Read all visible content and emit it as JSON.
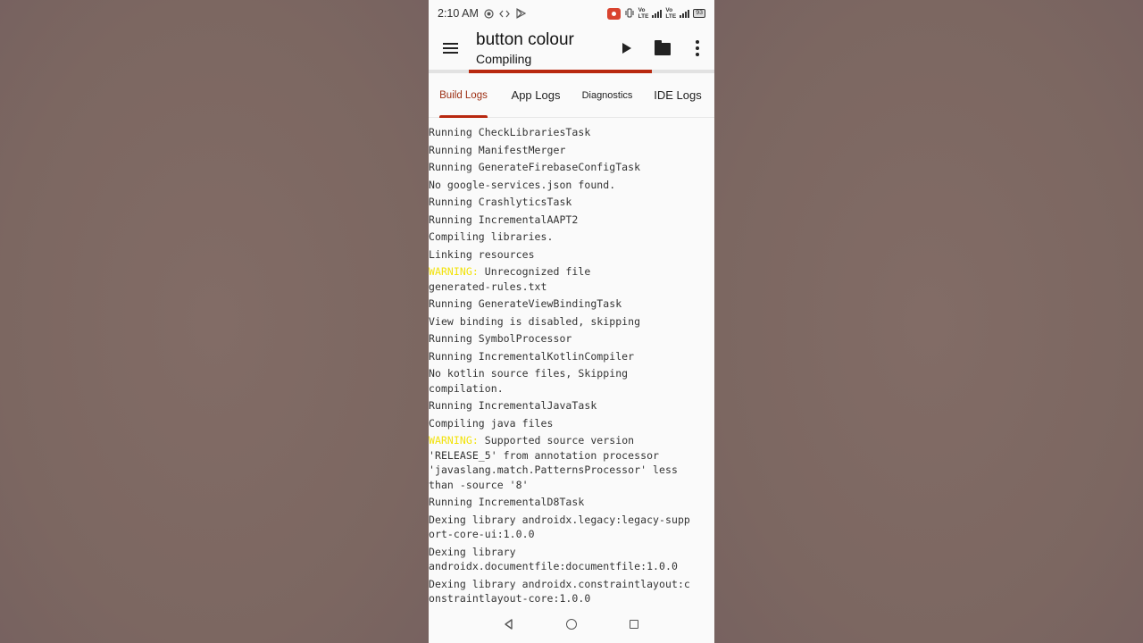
{
  "status_bar": {
    "time": "2:10 AM",
    "sim1_label_top": "Vo",
    "sim1_label_bottom": "LTE",
    "sim2_label_top": "Vo",
    "sim2_label_bottom": "LTE",
    "battery": "93",
    "icons": [
      "record-icon",
      "code-icon",
      "play-store-icon",
      "screen-record-icon",
      "vibrate-icon",
      "signal-icon",
      "battery-icon"
    ]
  },
  "toolbar": {
    "title": "button colour",
    "subtitle": "Compiling",
    "progress_fraction": 0.64,
    "progress_start_fraction": 0.14
  },
  "tabs": [
    {
      "label": "Build Logs",
      "active": true
    },
    {
      "label": "App Logs",
      "active": false
    },
    {
      "label": "Diagnostics",
      "active": false
    },
    {
      "label": "IDE Logs",
      "active": false
    }
  ],
  "log": {
    "lines": [
      {
        "warning": "",
        "text": "Running CheckLibrariesTask"
      },
      {
        "warning": "",
        "text": "Running ManifestMerger"
      },
      {
        "warning": "",
        "text": "Running GenerateFirebaseConfigTask"
      },
      {
        "warning": "",
        "text": "No google-services.json found."
      },
      {
        "warning": "",
        "text": "Running CrashlyticsTask"
      },
      {
        "warning": "",
        "text": "Running IncrementalAAPT2"
      },
      {
        "warning": "",
        "text": "Compiling libraries."
      },
      {
        "warning": "",
        "text": "Linking resources"
      },
      {
        "warning": "WARNING:",
        "text": " Unrecognized file\ngenerated-rules.txt"
      },
      {
        "warning": "",
        "text": "Running GenerateViewBindingTask"
      },
      {
        "warning": "",
        "text": "View binding is disabled, skipping"
      },
      {
        "warning": "",
        "text": "Running SymbolProcessor"
      },
      {
        "warning": "",
        "text": "Running IncrementalKotlinCompiler"
      },
      {
        "warning": "",
        "text": "No kotlin source files, Skipping\ncompilation."
      },
      {
        "warning": "",
        "text": "Running IncrementalJavaTask"
      },
      {
        "warning": "",
        "text": "Compiling java files"
      },
      {
        "warning": "WARNING:",
        "text": " Supported source version\n'RELEASE_5' from annotation processor\n'javaslang.match.PatternsProcessor' less\nthan -source '8'"
      },
      {
        "warning": "",
        "text": "Running IncrementalD8Task"
      },
      {
        "warning": "",
        "text": "Dexing library androidx.legacy:legacy-supp\nort-core-ui:1.0.0"
      },
      {
        "warning": "",
        "text": "Dexing library\nandroidx.documentfile:documentfile:1.0.0"
      },
      {
        "warning": "",
        "text": "Dexing library androidx.constraintlayout:c\nonstraintlayout-core:1.0.0"
      }
    ]
  },
  "colors": {
    "accent": "#b8280f",
    "active_tab_text": "#9c2e12",
    "warning": "#f2e20a",
    "background": "#7f6a64"
  }
}
